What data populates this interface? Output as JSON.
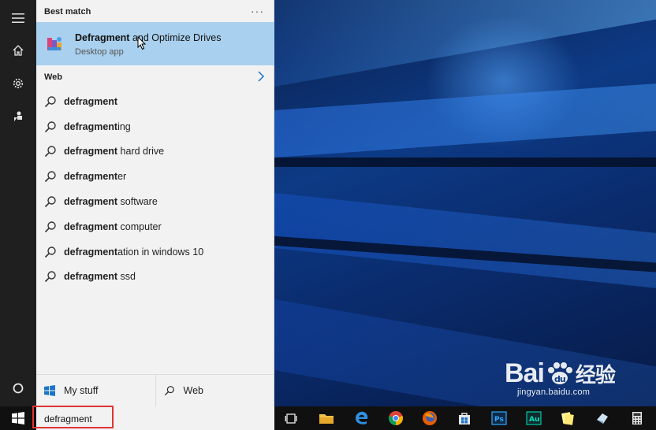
{
  "best_match": {
    "header": "Best match",
    "title_bold": "Defragment",
    "title_rest": " and Optimize Drives",
    "subtitle": "Desktop app"
  },
  "web_section": {
    "header": "Web",
    "items": [
      {
        "bold": "defragment",
        "rest": ""
      },
      {
        "bold": "defragment",
        "rest": "ing"
      },
      {
        "bold": "defragment",
        "rest": " hard drive"
      },
      {
        "bold": "defragment",
        "rest": "er"
      },
      {
        "bold": "defragment",
        "rest": " software"
      },
      {
        "bold": "defragment",
        "rest": " computer"
      },
      {
        "bold": "defragment",
        "rest": "ation in windows 10"
      },
      {
        "bold": "defragment",
        "rest": " ssd"
      }
    ]
  },
  "bottom_tabs": {
    "my_stuff": "My stuff",
    "web": "Web"
  },
  "search": {
    "value": "defragment"
  },
  "taskbar": {
    "pinned": [
      "task-view",
      "file-explorer",
      "edge",
      "chrome",
      "firefox",
      "store",
      "photoshop",
      "audition",
      "notes",
      "app",
      "calculator"
    ]
  },
  "watermark": {
    "logo_left": "Bai",
    "logo_right": "经验",
    "url": "jingyan.baidu.com"
  },
  "colors": {
    "best_match_bg": "#a9d0ee",
    "panel_bg": "#f2f2f2",
    "rail_bg": "#1f1f1f",
    "highlight_outline": "#e03434"
  }
}
